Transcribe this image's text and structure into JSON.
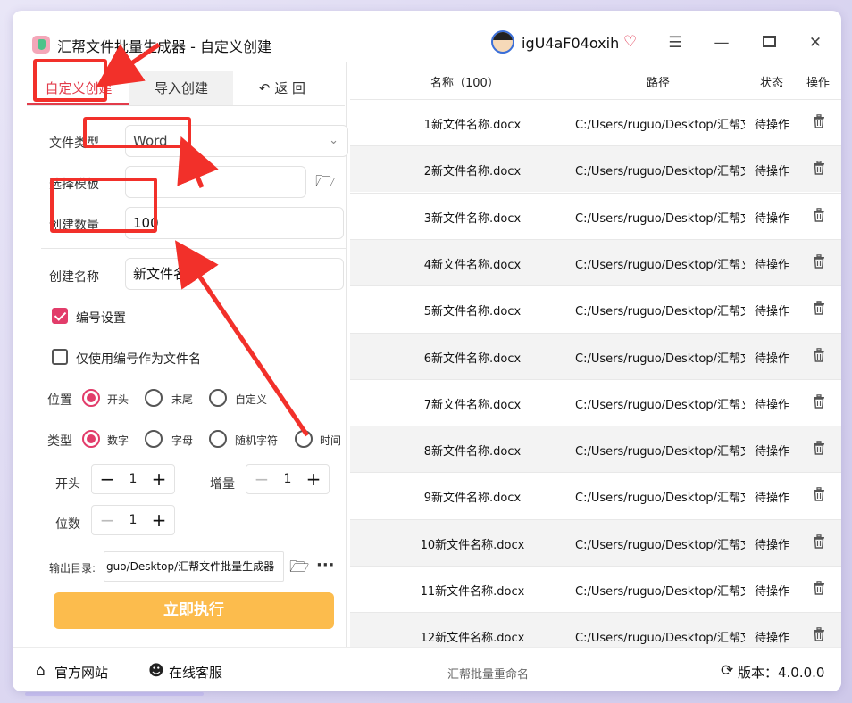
{
  "window": {
    "title": "汇帮文件批量生成器 - 自定义创建",
    "username": "igU4aF04oxih",
    "icons": {
      "logo": "app-logo-icon",
      "avatar": "user-avatar",
      "vip": "vip-diamond-icon",
      "menu": "hamburger-menu-icon",
      "minimize": "minimize-icon",
      "maximize": "maximize-icon",
      "close": "close-icon"
    }
  },
  "tabs": {
    "custom": "自定义创建",
    "import": "导入创建",
    "back": "返 回"
  },
  "form": {
    "file_type_label": "文件类型",
    "file_type_value": "Word",
    "template_label": "选择模板",
    "template_value": "",
    "count_label": "创建数量",
    "count_value": "100",
    "name_label": "创建名称",
    "name_value": "新文件名称",
    "numbering_label": "编号设置",
    "numbering_checked": true,
    "only_number_label": "仅使用编号作为文件名",
    "only_number_checked": false,
    "position_label": "位置",
    "position_options": [
      "开头",
      "末尾",
      "自定义"
    ],
    "position_selected": "开头",
    "type_label": "类型",
    "type_options": [
      "数字",
      "字母",
      "随机字符",
      "时间"
    ],
    "type_selected": "数字",
    "start_label": "开头",
    "start_value": "1",
    "increment_label": "增量",
    "increment_value": "1",
    "digits_label": "位数",
    "digits_value": "1",
    "output_label": "输出目录:",
    "output_value": "guo/Desktop/汇帮文件批量生成器",
    "more_label": "···",
    "run_button": "立即执行"
  },
  "table": {
    "headers": [
      "名称（100）",
      "路径",
      "状态",
      "操作"
    ],
    "rows": [
      {
        "name": "1新文件名称.docx",
        "path": "C:/Users/ruguo/Desktop/汇帮文",
        "status": "待操作"
      },
      {
        "name": "2新文件名称.docx",
        "path": "C:/Users/ruguo/Desktop/汇帮文",
        "status": "待操作"
      },
      {
        "name": "3新文件名称.docx",
        "path": "C:/Users/ruguo/Desktop/汇帮文",
        "status": "待操作"
      },
      {
        "name": "4新文件名称.docx",
        "path": "C:/Users/ruguo/Desktop/汇帮文",
        "status": "待操作"
      },
      {
        "name": "5新文件名称.docx",
        "path": "C:/Users/ruguo/Desktop/汇帮文",
        "status": "待操作"
      },
      {
        "name": "6新文件名称.docx",
        "path": "C:/Users/ruguo/Desktop/汇帮文",
        "status": "待操作"
      },
      {
        "name": "7新文件名称.docx",
        "path": "C:/Users/ruguo/Desktop/汇帮文",
        "status": "待操作"
      },
      {
        "name": "8新文件名称.docx",
        "path": "C:/Users/ruguo/Desktop/汇帮文",
        "status": "待操作"
      },
      {
        "name": "9新文件名称.docx",
        "path": "C:/Users/ruguo/Desktop/汇帮文",
        "status": "待操作"
      },
      {
        "name": "10新文件名称.docx",
        "path": "C:/Users/ruguo/Desktop/汇帮文",
        "status": "待操作"
      },
      {
        "name": "11新文件名称.docx",
        "path": "C:/Users/ruguo/Desktop/汇帮文",
        "status": "待操作"
      },
      {
        "name": "12新文件名称.docx",
        "path": "C:/Users/ruguo/Desktop/汇帮文",
        "status": "待操作"
      }
    ],
    "row_action_icon": "trash-icon"
  },
  "statusbar": {
    "website": "官方网站",
    "support": "在线客服",
    "center": "汇帮批量重命名",
    "version": "版本：4.0.0.0"
  },
  "colors": {
    "accent": "#e23c6a",
    "tab_active": "#e23c4b",
    "run_button": "#fcbc4d",
    "annotation": "#f2302a"
  }
}
